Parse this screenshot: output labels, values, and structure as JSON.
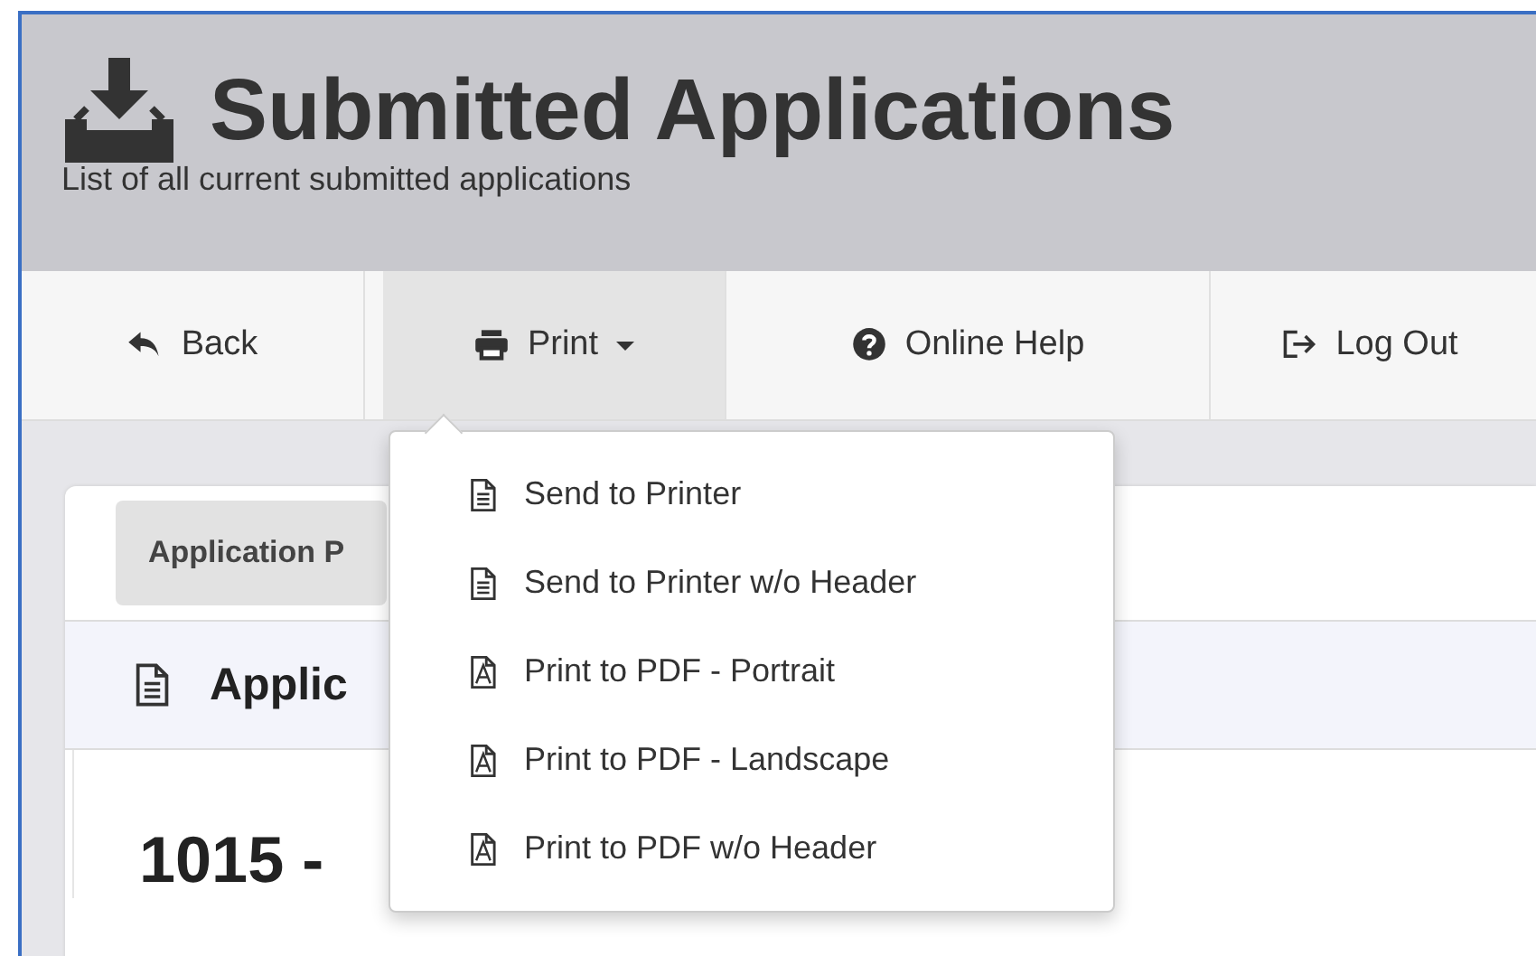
{
  "header": {
    "title": "Submitted Applications",
    "subtitle": "List of all current submitted applications"
  },
  "nav": [
    {
      "label": "Back",
      "selected": false,
      "dropdown": false
    },
    {
      "label": "Print",
      "selected": true,
      "dropdown": true
    },
    {
      "label": "Online Help",
      "selected": false,
      "dropdown": false
    },
    {
      "label": "Log Out",
      "selected": false,
      "dropdown": false
    }
  ],
  "print_menu": [
    {
      "label": "Send to Printer",
      "kind": "document"
    },
    {
      "label": "Send to Printer w/o Header",
      "kind": "document"
    },
    {
      "label": "Print to PDF - Portrait",
      "kind": "pdf"
    },
    {
      "label": "Print to PDF - Landscape",
      "kind": "pdf"
    },
    {
      "label": "Print to PDF w/o Header",
      "kind": "pdf"
    }
  ],
  "card": {
    "tab": "Application P",
    "panel_title": "Applic",
    "heading": "1015 -"
  }
}
